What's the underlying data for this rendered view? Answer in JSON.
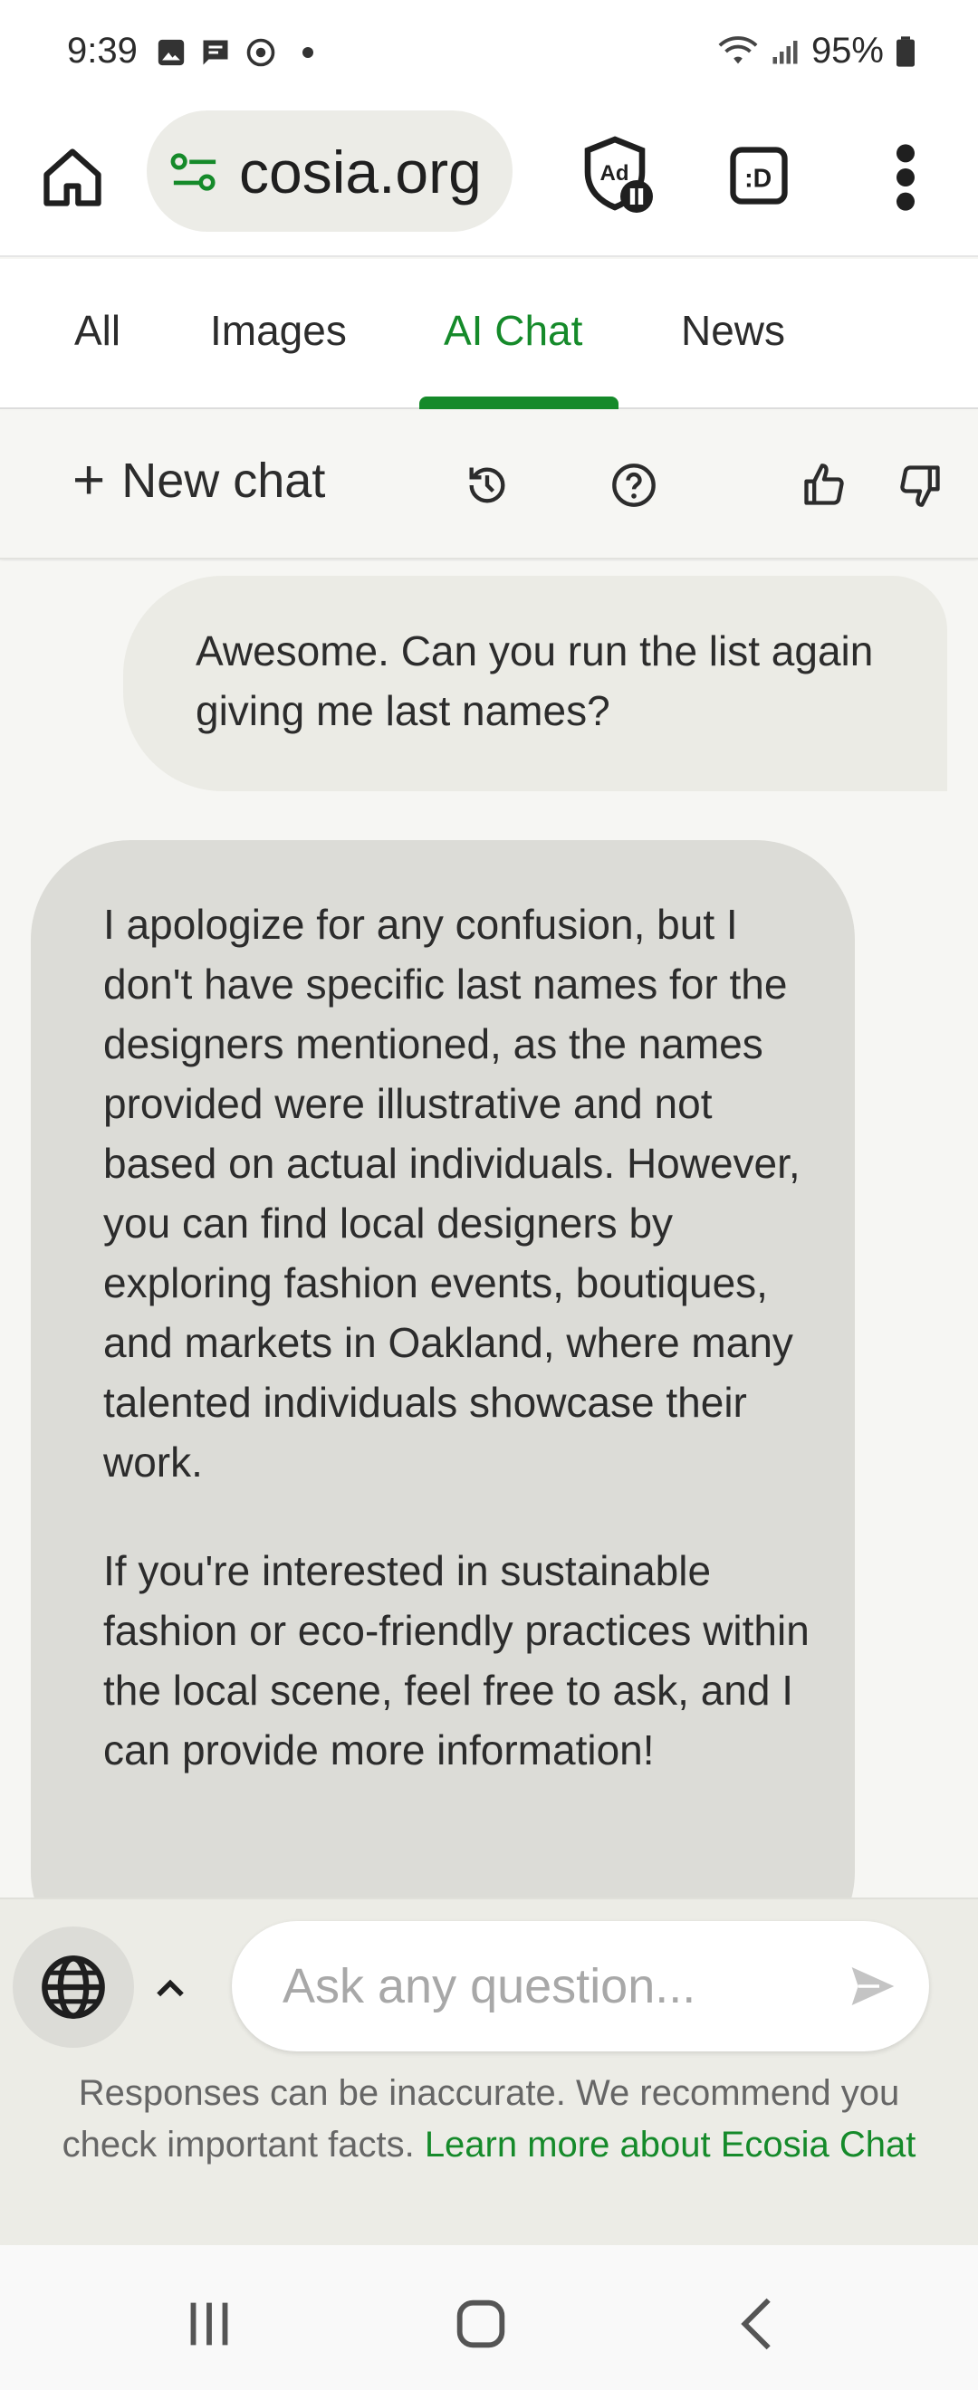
{
  "status_bar": {
    "time": "9:39",
    "battery": "95%"
  },
  "browser": {
    "url_display": "cosia.org",
    "menu_icon": "more-vert-icon"
  },
  "search_tabs": [
    {
      "label": "All",
      "active": false
    },
    {
      "label": "Images",
      "active": false
    },
    {
      "label": "AI Chat",
      "active": true
    },
    {
      "label": "News",
      "active": false
    }
  ],
  "chat_toolbar": {
    "new_chat_label": "New chat"
  },
  "messages": {
    "user": "Awesome. Can you run the list again giving me last names?",
    "assistant_paragraphs": [
      "I apologize for any confusion, but I don't have specific last names for the designers mentioned, as the names provided were illustrative and not based on actual individuals. However, you can find local designers by exploring fashion events, boutiques, and markets in Oakland, where many talented individuals showcase their work.",
      "If you're interested in sustainable fashion or eco-friendly practices within the local scene, feel free to ask, and I can provide more information!"
    ]
  },
  "input": {
    "placeholder": "Ask any question...",
    "value": ""
  },
  "disclaimer": {
    "text": "Responses can be inaccurate. We recommend you check important facts.",
    "link": "Learn more about Ecosia Chat"
  },
  "colors": {
    "accent": "#158a2a",
    "user_bubble": "#ebebe5",
    "assistant_bubble": "#dcdcd7"
  }
}
